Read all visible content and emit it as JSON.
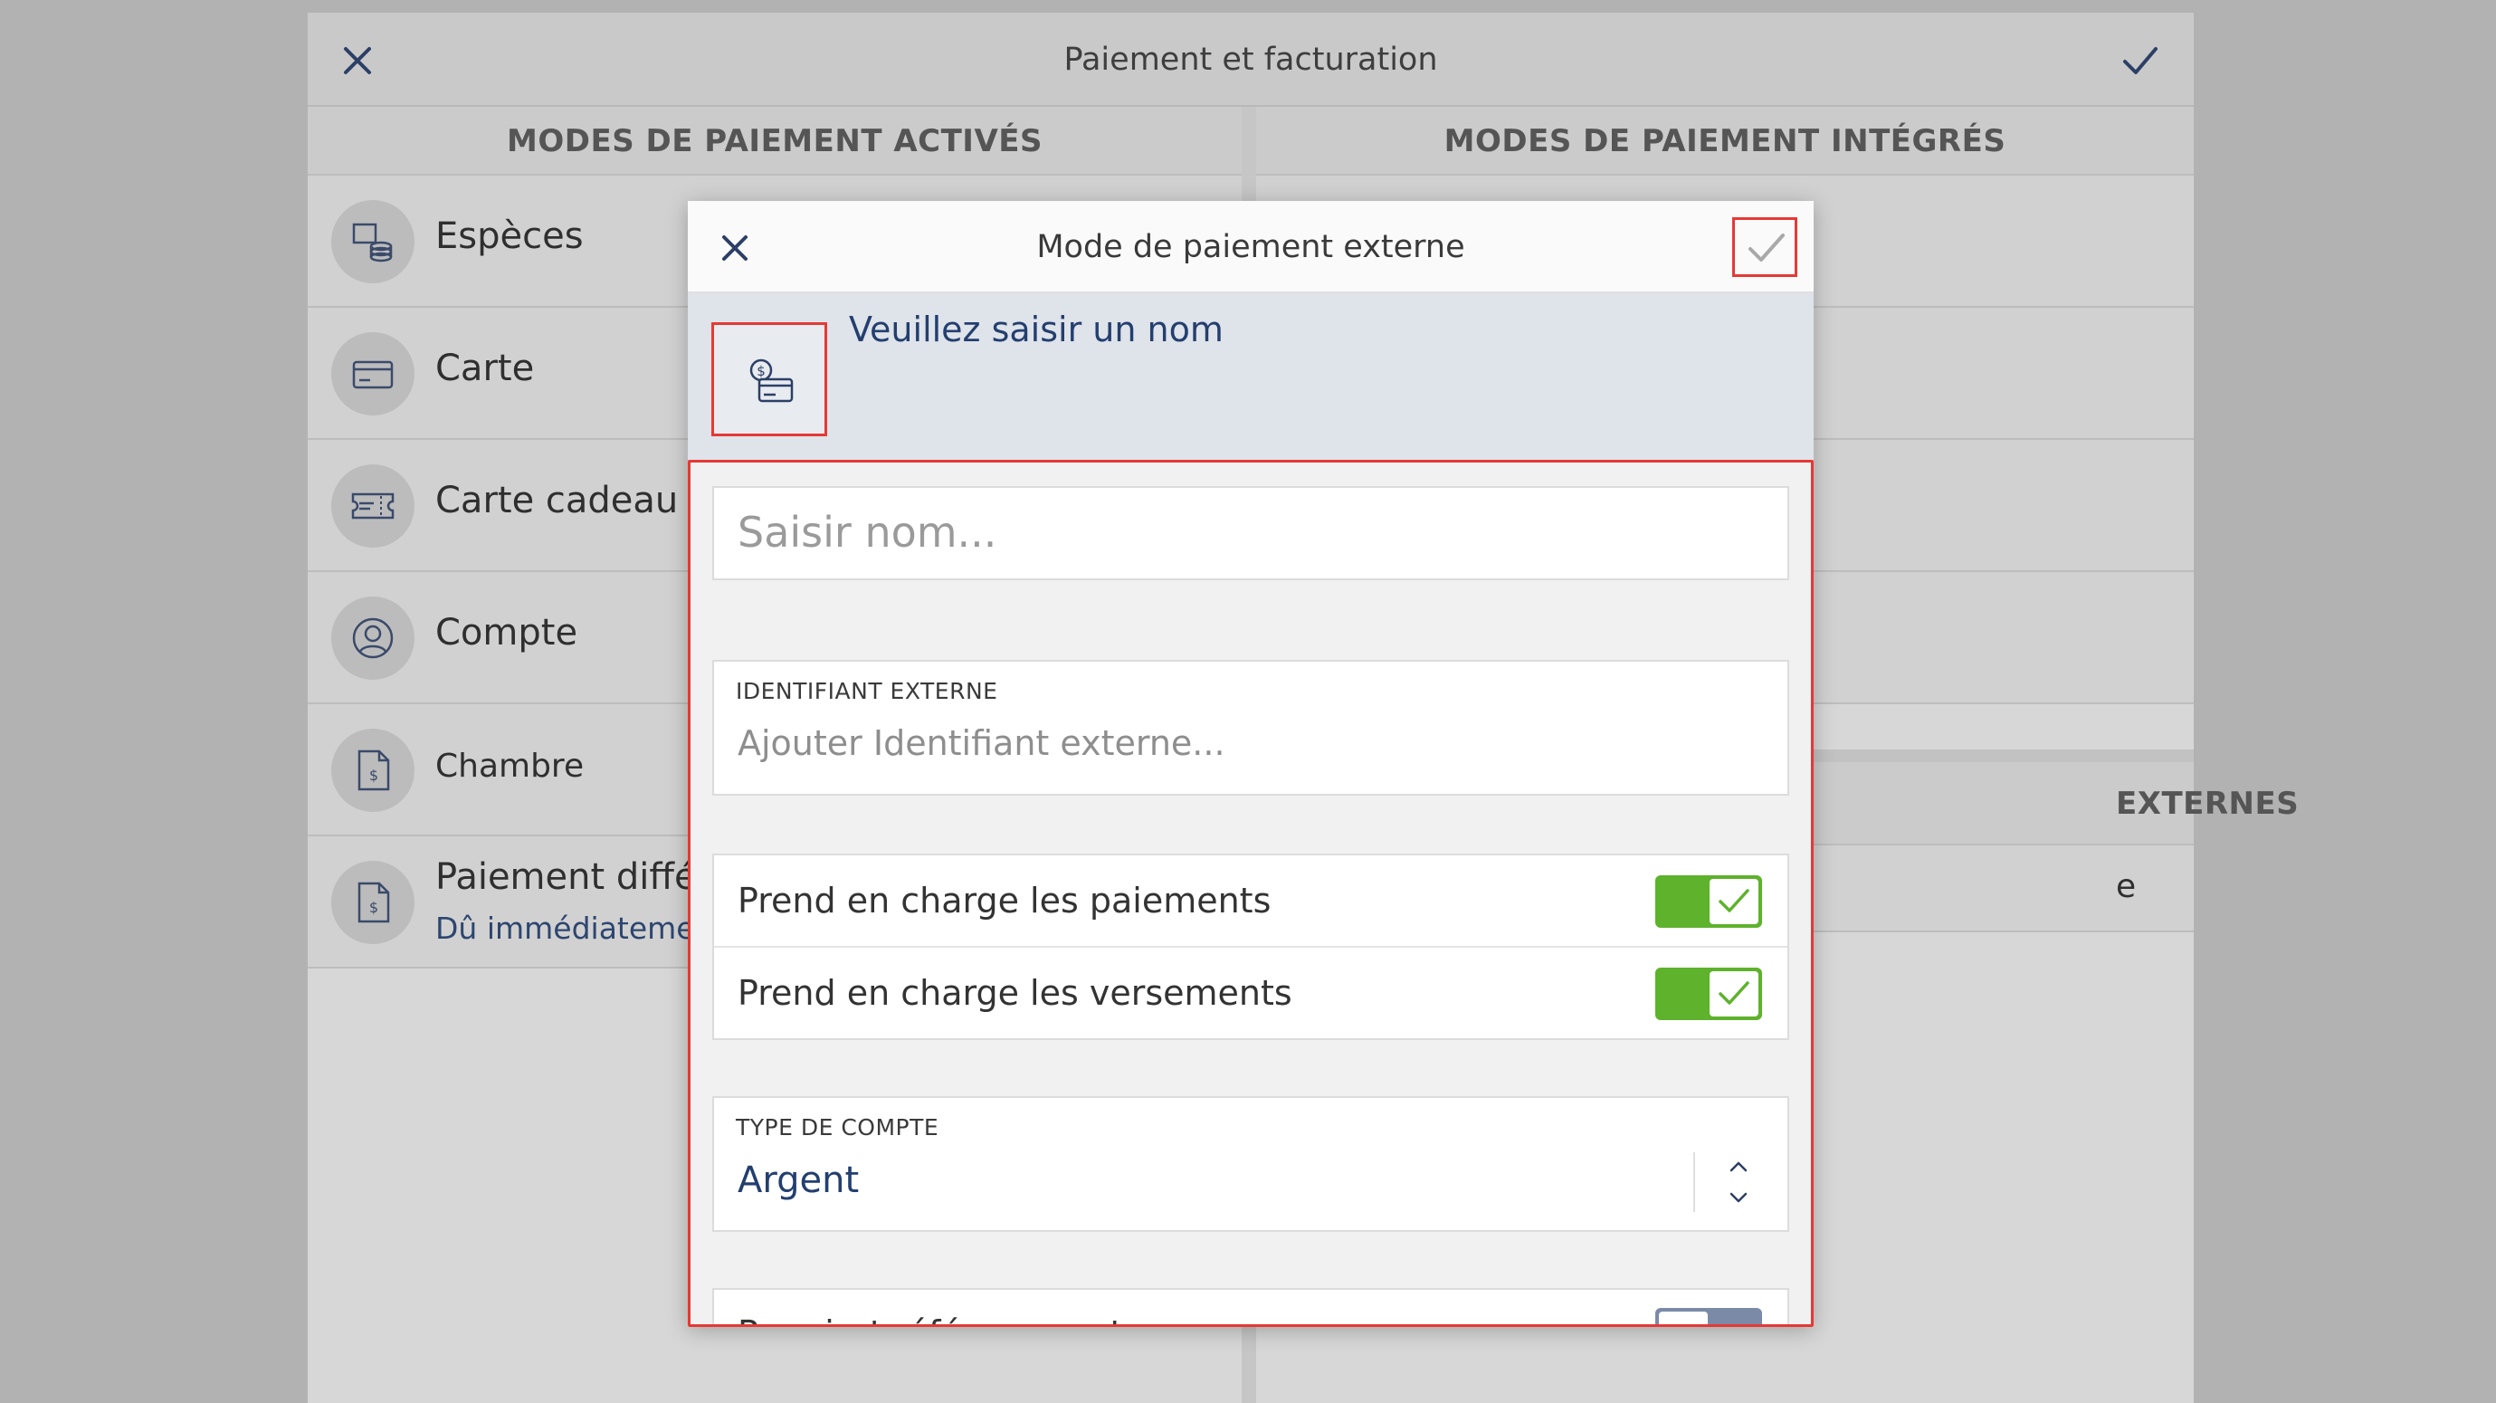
{
  "app": {
    "title": "Paiement et facturation",
    "close_icon": "close-icon",
    "confirm_icon": "checkmark-icon"
  },
  "sections": {
    "left_title": "MODES DE PAIEMENT ACTIVÉS",
    "right_title": "MODES DE PAIEMENT INTÉGRÉS",
    "right_external_title_partial": "EXTERNES",
    "right_external_row_partial": "e"
  },
  "payment_methods": [
    {
      "label": "Espèces",
      "icon": "cash-coins-icon"
    },
    {
      "label": "Carte",
      "icon": "credit-card-icon"
    },
    {
      "label": "Carte cadeau",
      "icon": "gift-card-icon"
    },
    {
      "label": "Compte",
      "icon": "user-account-icon"
    },
    {
      "label": "Chambre",
      "icon": "room-document-icon"
    },
    {
      "label": "Paiement différé",
      "sublabel": "Dû immédiatement",
      "icon": "deferred-document-icon"
    }
  ],
  "modal": {
    "title": "Mode de paiement externe",
    "name_prompt": "Veuillez saisir un nom",
    "icon": "external-payment-icon",
    "name_input": {
      "value": "",
      "placeholder": "Saisir nom..."
    },
    "external_id": {
      "label": "IDENTIFIANT EXTERNE",
      "value": "",
      "placeholder": "Ajouter Identifiant externe..."
    },
    "toggles": [
      {
        "label": "Prend en charge les paiements",
        "on": true
      },
      {
        "label": "Prend en charge les versements",
        "on": true
      }
    ],
    "account_type": {
      "label": "TYPE DE COMPTE",
      "value": "Argent"
    },
    "requires_reference": {
      "label": "Requiert référence externe",
      "on": false
    }
  },
  "colors": {
    "accent_red": "#e53935",
    "toggle_on": "#5eb22c",
    "toggle_off": "#7b8aa6",
    "navy_text": "#233f6f"
  }
}
